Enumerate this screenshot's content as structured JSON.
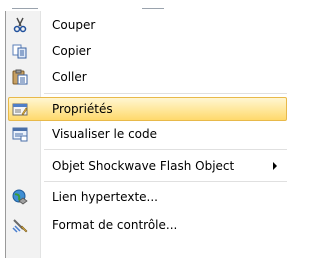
{
  "menu": {
    "items": [
      {
        "label": "Couper",
        "icon": "scissors-icon"
      },
      {
        "label": "Copier",
        "icon": "copy-icon"
      },
      {
        "label": "Coller",
        "icon": "paste-icon"
      },
      {
        "label": "Propriétés",
        "icon": "properties-icon",
        "highlighted": true
      },
      {
        "label": "Visualiser le code",
        "icon": "view-code-icon"
      },
      {
        "label": "Objet Shockwave Flash Object",
        "submenu": true
      },
      {
        "label": "Lien hypertexte...",
        "icon": "hyperlink-icon"
      },
      {
        "label": "Format de contrôle...",
        "icon": "format-control-icon"
      }
    ]
  },
  "colors": {
    "highlight_top": "#fff6d2",
    "highlight_bottom": "#ffd96c",
    "highlight_border": "#e8b94a",
    "gutter": "#f2f2f2"
  }
}
